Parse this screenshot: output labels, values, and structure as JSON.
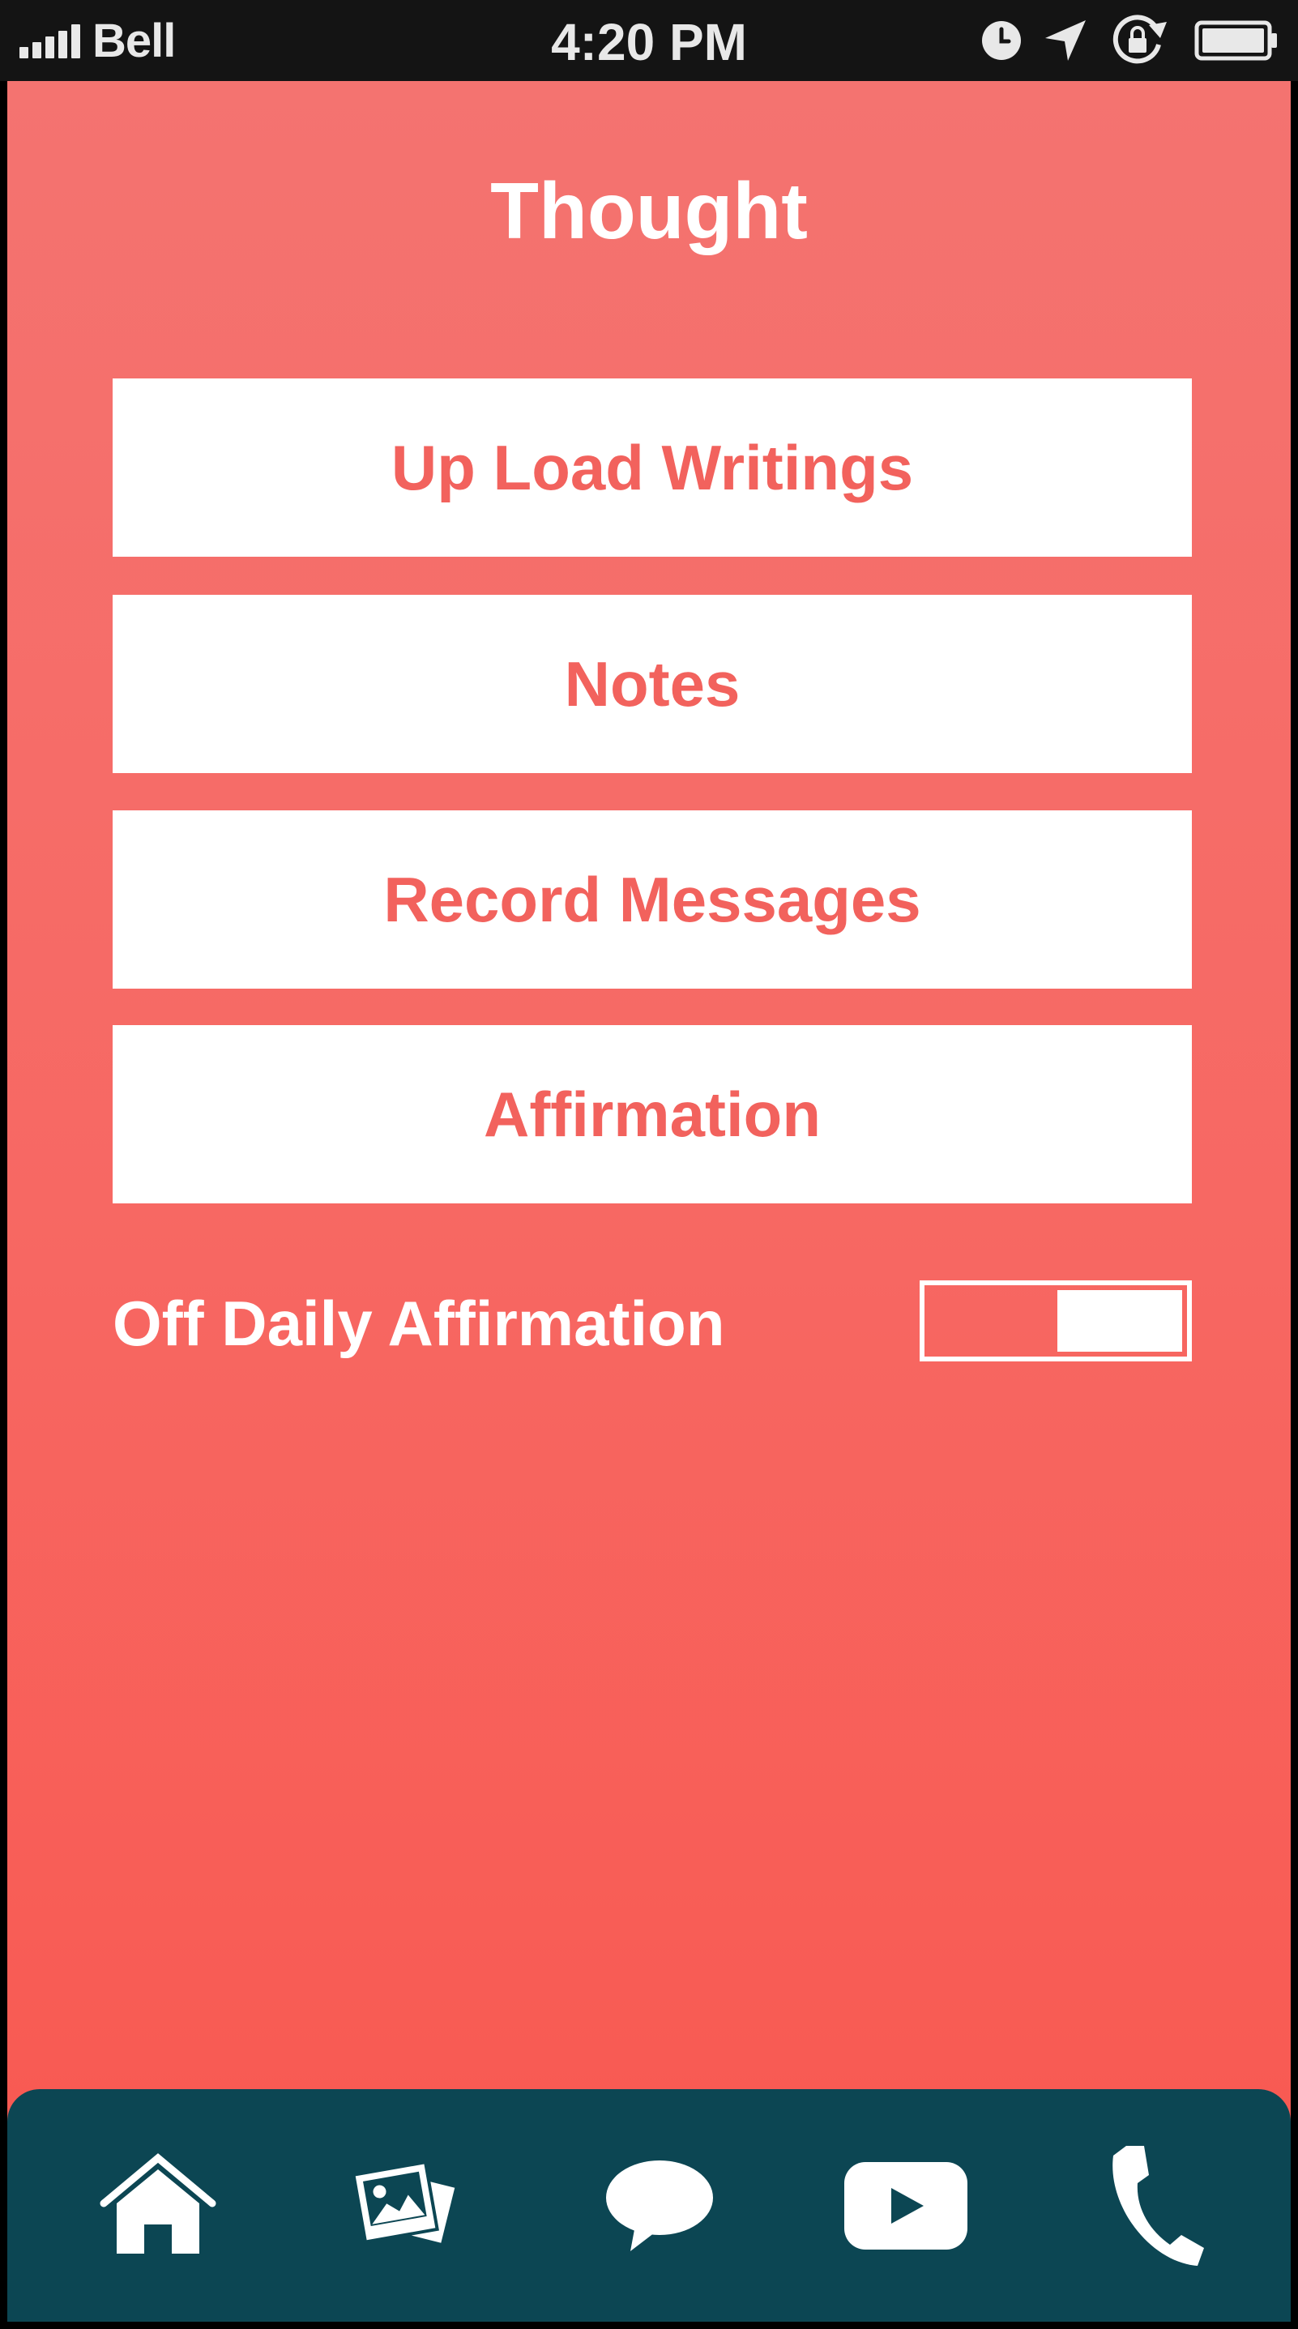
{
  "status_bar": {
    "carrier": "Bell",
    "time": "4:20 PM"
  },
  "page": {
    "title": "Thought"
  },
  "menu": {
    "items": [
      {
        "label": "Up Load Writings"
      },
      {
        "label": "Notes"
      },
      {
        "label": "Record Messages"
      },
      {
        "label": "Affirmation"
      }
    ]
  },
  "daily_affirmation": {
    "label": "Off Daily Affirmation",
    "enabled": false
  },
  "tab_bar": {
    "items": [
      {
        "icon": "home-icon"
      },
      {
        "icon": "gallery-icon"
      },
      {
        "icon": "chat-icon"
      },
      {
        "icon": "video-icon"
      },
      {
        "icon": "phone-icon"
      }
    ]
  },
  "colors": {
    "background_top": "#f47370",
    "background_bottom": "#f8574f",
    "accent_text": "#f2625d",
    "tab_bar": "#0c4653",
    "status_bar": "#141414"
  }
}
